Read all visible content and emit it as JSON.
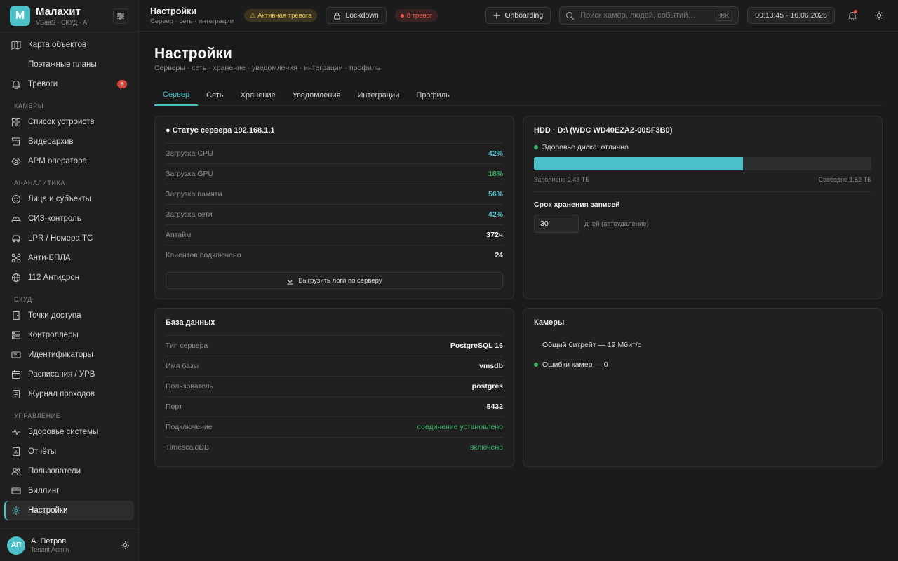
{
  "brand": {
    "logo_letter": "М",
    "name": "Малахит",
    "subtitle": "VSaaS · СКУД · AI"
  },
  "sidebar": {
    "top": [
      {
        "label": "Карта объектов",
        "icon": "map-icon"
      },
      {
        "label": "Поэтажные планы",
        "icon": ""
      },
      {
        "label": "Тревоги",
        "icon": "bell-icon",
        "badge": "8"
      }
    ],
    "sections": [
      {
        "title": "КАМЕРЫ",
        "items": [
          {
            "label": "Список устройств"
          },
          {
            "label": "Видеоархив"
          },
          {
            "label": "АРМ оператора"
          }
        ]
      },
      {
        "title": "AI-АНАЛИТИКА",
        "items": [
          {
            "label": "Лица и субъекты"
          },
          {
            "label": "СИЗ-контроль"
          },
          {
            "label": "LPR / Номера ТС"
          },
          {
            "label": "Анти-БПЛА"
          },
          {
            "label": "112 Антидрон"
          }
        ]
      },
      {
        "title": "СКУД",
        "items": [
          {
            "label": "Точки доступа"
          },
          {
            "label": "Контроллеры"
          },
          {
            "label": "Идентификаторы"
          },
          {
            "label": "Расписания / УРВ"
          },
          {
            "label": "Журнал проходов"
          }
        ]
      },
      {
        "title": "УПРАВЛЕНИЕ",
        "items": [
          {
            "label": "Здоровье системы"
          },
          {
            "label": "Отчёты"
          },
          {
            "label": "Пользователи"
          },
          {
            "label": "Биллинг"
          },
          {
            "label": "Настройки"
          }
        ]
      }
    ]
  },
  "user": {
    "initials": "АП",
    "name": "А. Петров",
    "role": "Tenant Admin"
  },
  "topbar": {
    "title": "Настройки",
    "subtitle": "Сервер · сеть · интеграции",
    "alert_pill": "⚠ Активная тревога",
    "lockdown": "Lockdown",
    "alarms_pill": "8 тревог",
    "onboarding": "Onboarding",
    "search_placeholder": "Поиск камер, людей, событий…",
    "search_kbd": "⌘K",
    "clock": "00:13:45 · 16.06.2026"
  },
  "page": {
    "title": "Настройки",
    "subtitle": "Серверы · сеть · хранение · уведомления · интеграции · профиль",
    "tabs": [
      "Сервер",
      "Сеть",
      "Хранение",
      "Уведомления",
      "Интеграции",
      "Профиль"
    ]
  },
  "server": {
    "title": "● Статус сервера 192.168.1.1",
    "rows": [
      {
        "k": "Загрузка CPU",
        "v": "42%"
      },
      {
        "k": "Загрузка GPU",
        "v": "18%"
      },
      {
        "k": "Загрузка памяти",
        "v": "56%"
      },
      {
        "k": "Загрузка сети",
        "v": "42%"
      },
      {
        "k": "Аптайм",
        "v": "372ч"
      },
      {
        "k": "Клиентов подключено",
        "v": "24"
      }
    ],
    "export_label": "Выгрузить логи по серверу"
  },
  "hdd": {
    "title": "HDD · D:\\ (WDC WD40EZAZ-00SF3B0)",
    "health": "Здоровье диска: отлично",
    "fill_fraction": 0.62,
    "used": "Заполнено 2.48 ТБ",
    "free": "Свободно 1.52 ТБ",
    "retention_title": "Срок хранения записей",
    "retention_value": "30",
    "retention_unit": "дней (автоудаление)"
  },
  "db": {
    "title": "База данных",
    "rows": [
      {
        "k": "Тип сервера",
        "v": "PostgreSQL 16"
      },
      {
        "k": "Имя базы",
        "v": "vmsdb"
      },
      {
        "k": "Пользователь",
        "v": "postgres"
      },
      {
        "k": "Порт",
        "v": "5432"
      },
      {
        "k": "Подключение",
        "v": "соединение установлено"
      },
      {
        "k": "TimescaleDB",
        "v": "включено"
      }
    ]
  },
  "cameras": {
    "title": "Камеры",
    "bitrate": "Общий битрейт — 19 Мбит/с",
    "errors": "Ошибки камер — 0"
  },
  "colors": {
    "accent": "#4cc0c9",
    "ok": "#3bb36a",
    "alert": "#e85b50",
    "warn": "#e9c14b"
  }
}
